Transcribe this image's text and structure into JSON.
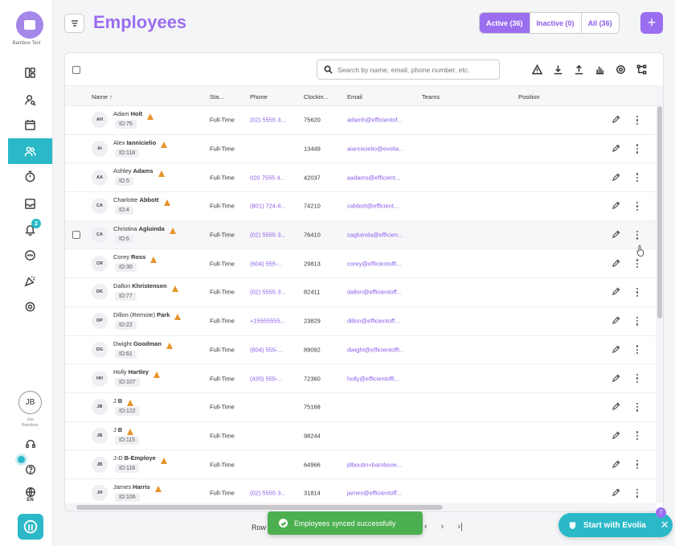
{
  "sidebar": {
    "org_name": "Bamboo Test",
    "notification_count": "2",
    "user_initials": "JB",
    "user_name_line1": "Joe",
    "user_name_line2": "Bamboo",
    "language": "EN"
  },
  "header": {
    "title": "Employees",
    "filters": [
      {
        "label": "Active (36)",
        "active": true
      },
      {
        "label": "Inactive (0)",
        "active": false
      },
      {
        "label": "All (36)",
        "active": false
      }
    ],
    "add_label": "+"
  },
  "toolbar": {
    "search_placeholder": "Search by name, email, phone number, etc."
  },
  "table": {
    "columns": {
      "name": "Name ↑",
      "status": "Sta...",
      "phone": "Phone",
      "clocking": "Clockin...",
      "email": "Email",
      "teams": "Teams",
      "position": "Position"
    },
    "rows": [
      {
        "initials": "AH",
        "first": "Adam",
        "last": "Holt",
        "id": "ID:75",
        "status": "Full-Time",
        "phone": "(02) 5555 3...",
        "clock": "75620",
        "email": "adamh@efficientof..."
      },
      {
        "initials": "AI",
        "first": "Alex",
        "last": "Iannicielio",
        "id": "ID:118",
        "status": "Full-Time",
        "phone": "",
        "clock": "13449",
        "email": "aiannicielio@evolia..."
      },
      {
        "initials": "AA",
        "first": "Ashley",
        "last": "Adams",
        "id": "ID:5",
        "status": "Full-Time",
        "phone": "020 7555 4...",
        "clock": "42037",
        "email": "aadams@efficient..."
      },
      {
        "initials": "CA",
        "first": "Charlotte",
        "last": "Abbott",
        "id": "ID:4",
        "status": "Full-Time",
        "phone": "(801) 724-6...",
        "clock": "74210",
        "email": "cabbott@efficient..."
      },
      {
        "initials": "CA",
        "first": "Christina",
        "last": "Agluinda",
        "id": "ID:6",
        "status": "Full-Time",
        "phone": "(02) 5555 3...",
        "clock": "76410",
        "email": "cagluinda@efficien..."
      },
      {
        "initials": "CR",
        "first": "Corey",
        "last": "Ross",
        "id": "ID:30",
        "status": "Full-Time",
        "phone": "(604) 555-...",
        "clock": "29813",
        "email": "corey@efficientoffi..."
      },
      {
        "initials": "DK",
        "first": "Dallon",
        "last": "Khristensen",
        "id": "ID:77",
        "status": "Full-Time",
        "phone": "(02) 5555 3...",
        "clock": "82411",
        "email": "dallon@efficientoff..."
      },
      {
        "initials": "DP",
        "first": "Dillon (Remote)",
        "last": "Park",
        "id": "ID:22",
        "status": "Full-Time",
        "phone": "+15555555...",
        "clock": "23829",
        "email": "dillon@efficientoff..."
      },
      {
        "initials": "DG",
        "first": "Dwight",
        "last": "Goodman",
        "id": "ID:61",
        "status": "Full-Time",
        "phone": "(604) 555-...",
        "clock": "89092",
        "email": "dwight@efficientoffi..."
      },
      {
        "initials": "HH",
        "first": "Holly",
        "last": "Hartley",
        "id": "ID:107",
        "status": "Full-Time",
        "phone": "(435) 555-...",
        "clock": "72360",
        "email": "holly@efficientoffi..."
      },
      {
        "initials": "JB",
        "first": "J",
        "last": "B",
        "id": "ID:122",
        "status": "Full-Time",
        "phone": "",
        "clock": "75168",
        "email": ""
      },
      {
        "initials": "JB",
        "first": "J",
        "last": "B",
        "id": "ID:115",
        "status": "Full-Time",
        "phone": "",
        "clock": "98244",
        "email": ""
      },
      {
        "initials": "JB",
        "first": "J-D",
        "last": "B-Employe",
        "id": "ID:116",
        "status": "Full-Time",
        "phone": "",
        "clock": "64966",
        "email": "jdboutin+bambooe..."
      },
      {
        "initials": "JH",
        "first": "James",
        "last": "Harris",
        "id": "ID:106",
        "status": "Full-Time",
        "phone": "(02) 5555 3...",
        "clock": "31814",
        "email": "james@efficientoff..."
      }
    ]
  },
  "footer": {
    "rows_label": "Row",
    "prev": "‹",
    "next": "›",
    "last": "›|"
  },
  "toast": {
    "message": "Employees synced successfully"
  },
  "evolia": {
    "label": "Start with Evolia",
    "badge": "7",
    "close": "✕"
  },
  "colors": {
    "brand_purple": "#9b6ef0",
    "teal": "#2bb9c8",
    "warning": "#e8932a",
    "success": "#4caf50"
  }
}
